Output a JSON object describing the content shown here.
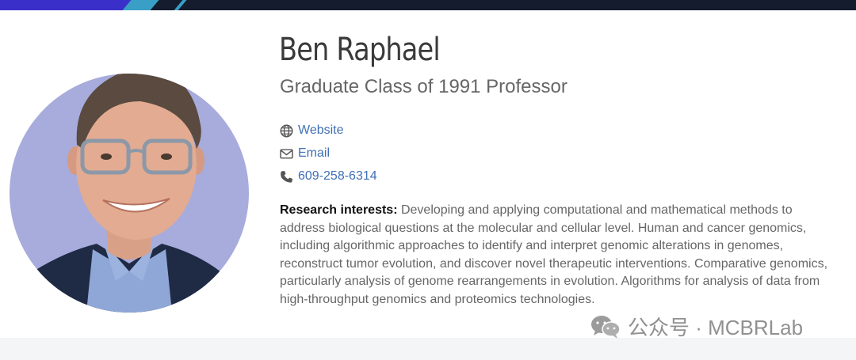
{
  "profile": {
    "name": "Ben Raphael",
    "title": "Graduate Class of 1991 Professor",
    "photo_alt": "Ben Raphael portrait"
  },
  "contacts": {
    "website": {
      "label": "Website",
      "icon": "globe-icon"
    },
    "email": {
      "label": "Email",
      "icon": "envelope-icon"
    },
    "phone": {
      "label": "609-258-6314",
      "icon": "phone-icon"
    }
  },
  "research": {
    "heading": "Research interests:",
    "text": " Developing and applying computational and mathematical methods to address biological questions at the molecular and cellular level. Human and cancer genomics, including algorithmic approaches to identify and interpret genomic alterations in genomes, reconstruct tumor evolution, and discover novel therapeutic interventions. Comparative genomics, particularly analysis of genome rearrangements in evolution. Algorithms for analysis of data from high-throughput genomics and proteomics technologies."
  },
  "watermark": {
    "text": "公众号 · MCBRLab",
    "icon": "wechat-icon"
  },
  "colors": {
    "link": "#3f6fb4",
    "header_bar": "#141c2e",
    "accent_purple": "#3b2fc9",
    "accent_teal": "#3a9fc7",
    "portrait_bg": "#a7acdc"
  }
}
